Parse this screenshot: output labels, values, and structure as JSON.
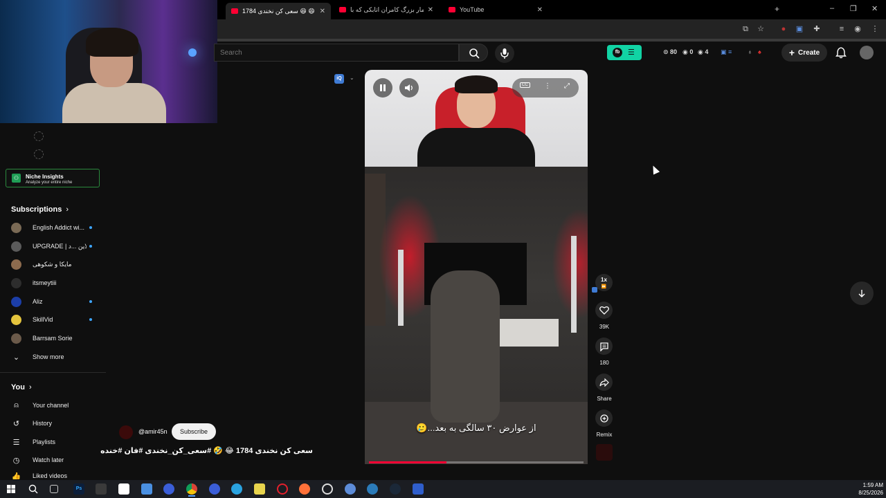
{
  "browser": {
    "tabs": [
      {
        "label": "سعی کن نخندی 1784 😆 😄",
        "active": true
      },
      {
        "label": "قمار بزرگ کامران اتابکی که با...",
        "active": false
      },
      {
        "label": "YouTube",
        "active": false
      }
    ],
    "new_tab": "+",
    "window_controls": [
      "–",
      "❐",
      "✕"
    ]
  },
  "masthead": {
    "search_placeholder": "Search",
    "stats": [
      "80",
      "0",
      "4"
    ],
    "create_label": "Create"
  },
  "sidebar": {
    "niche": {
      "title": "Niche Insights",
      "subtitle": "Analyze your entire niche"
    },
    "subscriptions_header": "Subscriptions",
    "subscriptions": [
      {
        "label": "English Addict wi...",
        "new": true,
        "color": "#7a6a55"
      },
      {
        "label": "UPGRADE | آنلاین ...د",
        "new": true,
        "color": "#5b5b5b"
      },
      {
        "label": "مایکا و شکوهی",
        "new": false,
        "color": "#8d6b4e"
      },
      {
        "label": "itsmeytiii",
        "new": false,
        "color": "#2d2d2d"
      },
      {
        "label": "Aliz",
        "new": true,
        "color": "#1c3ea8"
      },
      {
        "label": "SkillVid",
        "new": true,
        "color": "#e4c43d"
      },
      {
        "label": "Barrsam Sorie",
        "new": false,
        "color": "#6b5a4a"
      }
    ],
    "show_more": "Show more",
    "you_header": "You",
    "you_items": [
      {
        "label": "Your channel",
        "icon": "channel-icon"
      },
      {
        "label": "History",
        "icon": "history-icon"
      },
      {
        "label": "Playlists",
        "icon": "playlists-icon"
      },
      {
        "label": "Watch later",
        "icon": "watch-later-icon"
      },
      {
        "label": "Liked videos",
        "icon": "liked-icon"
      }
    ]
  },
  "short": {
    "caption": "از عوارض ۳۰ سالگی به بعد...🥲",
    "progress": 0.36,
    "channel": "@amir45n",
    "subscribe_label": "Subscribe",
    "title": "سعی کن نخندی 1784 😂 🤣 #سعی_کن_نخندی #فان #خنده"
  },
  "rail": {
    "speed": "1x",
    "likes": "39K",
    "comments": "180",
    "share": "Share",
    "remix": "Remix"
  },
  "taskbar": {
    "time": "1:59 AM",
    "date": "8/25/2026"
  }
}
